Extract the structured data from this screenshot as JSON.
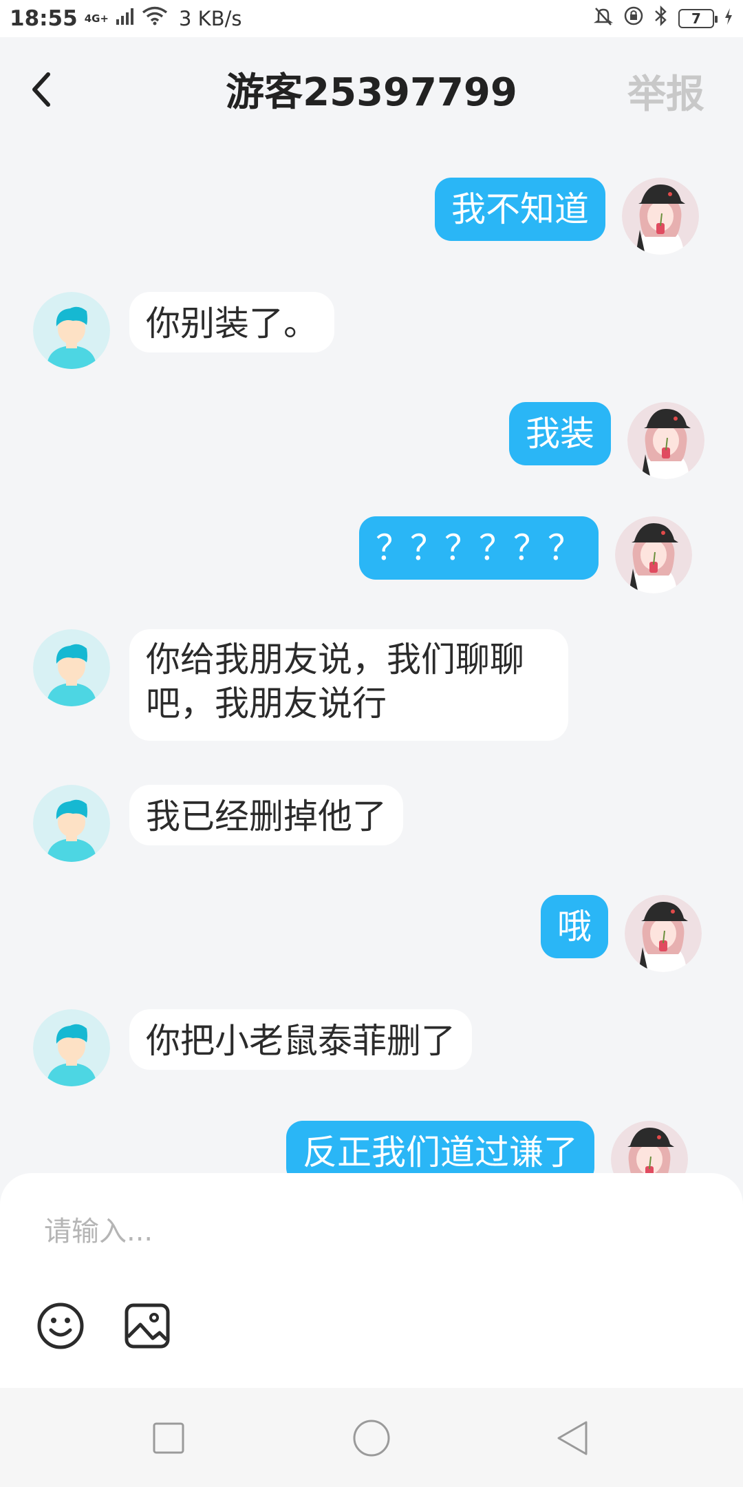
{
  "status_bar": {
    "time": "18:55",
    "network": "4G+",
    "speed": "3 KB/s",
    "battery": "7"
  },
  "header": {
    "title": "游客25397799",
    "report_label": "举报"
  },
  "messages": [
    {
      "side": "me",
      "text": "我不知道"
    },
    {
      "side": "other",
      "text": "你别装了。"
    },
    {
      "side": "me",
      "text": "我装"
    },
    {
      "side": "me",
      "text": "？？？？？？"
    },
    {
      "side": "other",
      "text": "你给我朋友说，我们聊聊吧，我朋友说行"
    },
    {
      "side": "other",
      "text": "我已经删掉他了"
    },
    {
      "side": "me",
      "text": "哦"
    },
    {
      "side": "other",
      "text": "你把小老鼠泰菲删了"
    },
    {
      "side": "me",
      "text": "反正我们道过谦了"
    }
  ],
  "input": {
    "placeholder": "请输入..."
  },
  "icons": {
    "back": "chevron-left-icon",
    "emoji": "emoji-icon",
    "image": "image-icon",
    "nav_recent": "square-icon",
    "nav_home": "circle-icon",
    "nav_back": "triangle-back-icon"
  },
  "colors": {
    "accent": "#2ab6f6",
    "background": "#f4f5f7",
    "report": "#c8c8c8"
  }
}
